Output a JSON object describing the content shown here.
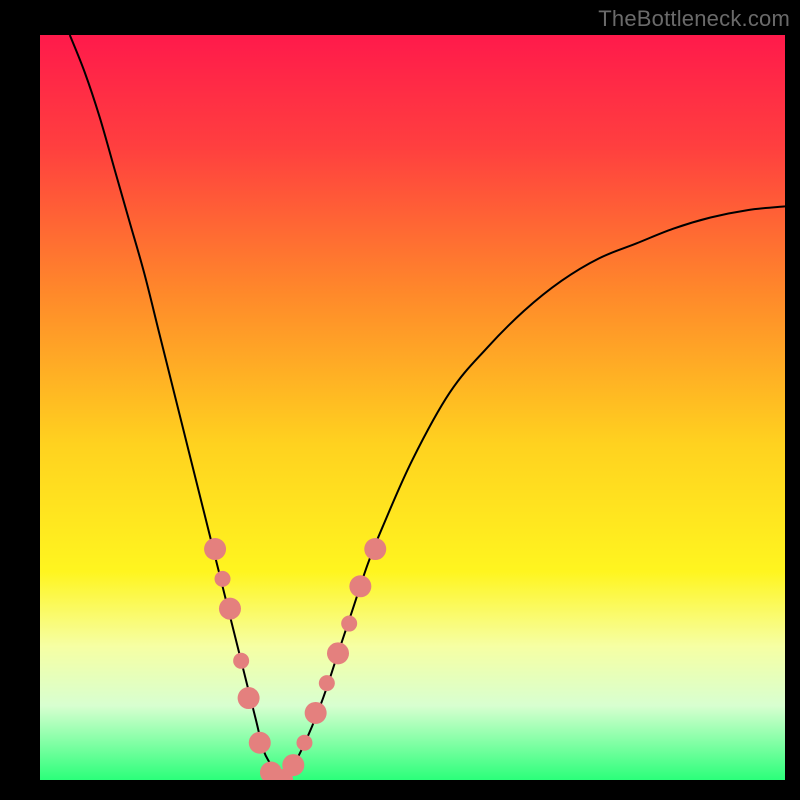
{
  "watermark": "TheBottleneck.com",
  "chart_data": {
    "type": "line",
    "title": "",
    "xlabel": "",
    "ylabel": "",
    "xlim": [
      0,
      100
    ],
    "ylim": [
      0,
      100
    ],
    "grid": false,
    "background_gradient": {
      "stops": [
        {
          "offset": 0.0,
          "color": "#ff1a4b"
        },
        {
          "offset": 0.15,
          "color": "#ff3f3f"
        },
        {
          "offset": 0.35,
          "color": "#ff8a2a"
        },
        {
          "offset": 0.55,
          "color": "#ffd21f"
        },
        {
          "offset": 0.72,
          "color": "#fff51f"
        },
        {
          "offset": 0.82,
          "color": "#f6ffa3"
        },
        {
          "offset": 0.9,
          "color": "#d8ffd0"
        },
        {
          "offset": 1.0,
          "color": "#2bff7a"
        }
      ]
    },
    "series": [
      {
        "name": "bottleneck-curve",
        "color": "#000000",
        "x": [
          4,
          6,
          8,
          10,
          12,
          14,
          16,
          18,
          20,
          22,
          24,
          26,
          28,
          29,
          30,
          31,
          32,
          34,
          36,
          38,
          40,
          42,
          44,
          46,
          50,
          55,
          60,
          65,
          70,
          75,
          80,
          85,
          90,
          95,
          100
        ],
        "y": [
          100,
          95,
          89,
          82,
          75,
          68,
          60,
          52,
          44,
          36,
          28,
          20,
          12,
          8,
          4,
          2,
          0,
          2,
          6,
          11,
          17,
          23,
          29,
          34,
          43,
          52,
          58,
          63,
          67,
          70,
          72,
          74,
          75.5,
          76.5,
          77
        ]
      }
    ],
    "markers": {
      "name": "highlight-dots",
      "color": "#e4807e",
      "radius_major": 11,
      "radius_minor": 8,
      "points": [
        {
          "x": 23.5,
          "y": 31,
          "r": "major"
        },
        {
          "x": 24.5,
          "y": 27,
          "r": "minor"
        },
        {
          "x": 25.5,
          "y": 23,
          "r": "major"
        },
        {
          "x": 27.0,
          "y": 16,
          "r": "minor"
        },
        {
          "x": 28.0,
          "y": 11,
          "r": "major"
        },
        {
          "x": 29.5,
          "y": 5,
          "r": "major"
        },
        {
          "x": 31.0,
          "y": 1,
          "r": "major"
        },
        {
          "x": 32.5,
          "y": 0,
          "r": "major"
        },
        {
          "x": 34.0,
          "y": 2,
          "r": "major"
        },
        {
          "x": 35.5,
          "y": 5,
          "r": "minor"
        },
        {
          "x": 37.0,
          "y": 9,
          "r": "major"
        },
        {
          "x": 38.5,
          "y": 13,
          "r": "minor"
        },
        {
          "x": 40.0,
          "y": 17,
          "r": "major"
        },
        {
          "x": 41.5,
          "y": 21,
          "r": "minor"
        },
        {
          "x": 43.0,
          "y": 26,
          "r": "major"
        },
        {
          "x": 45.0,
          "y": 31,
          "r": "major"
        }
      ]
    }
  }
}
